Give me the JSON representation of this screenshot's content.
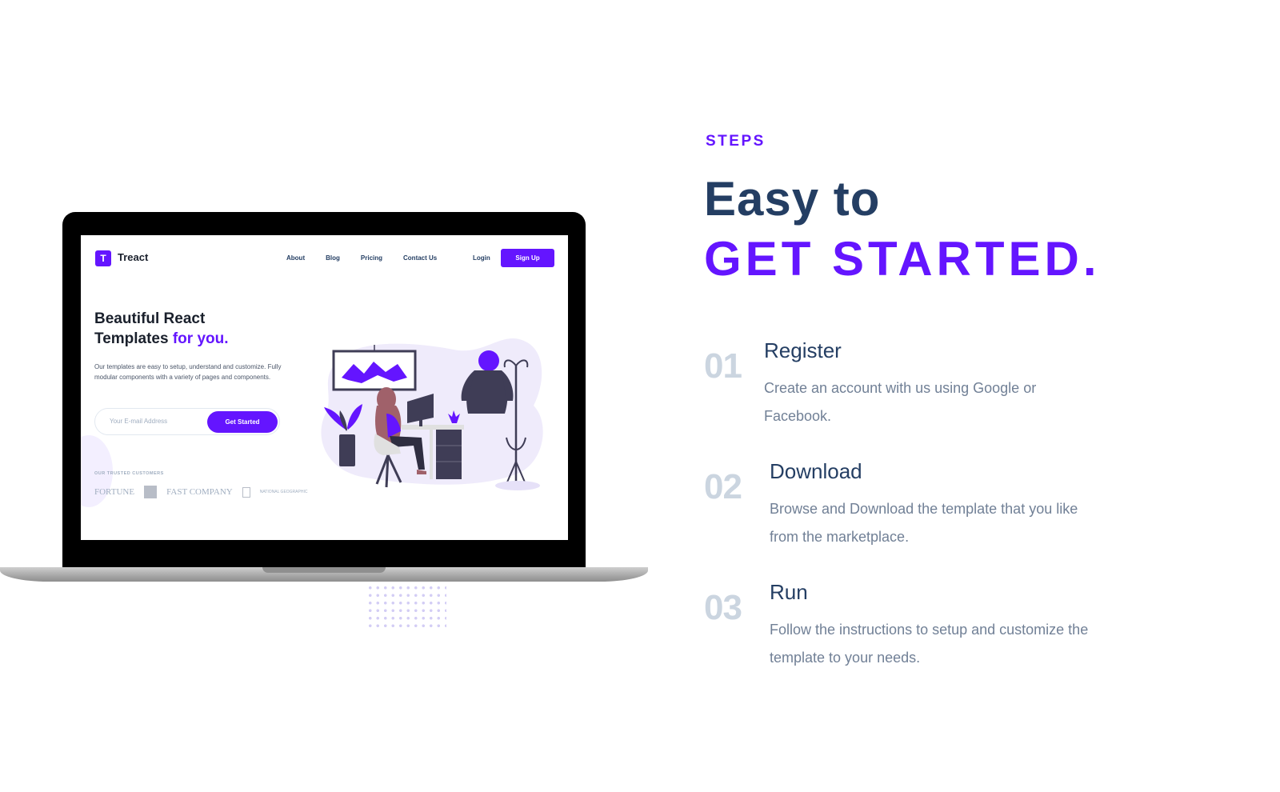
{
  "mockup": {
    "logo_letter": "T",
    "logo_text": "Treact",
    "nav_links": [
      "About",
      "Blog",
      "Pricing",
      "Contact Us"
    ],
    "login": "Login",
    "signup": "Sign Up",
    "title_line1": "Beautiful React",
    "title_line2_plain": "Templates ",
    "title_line2_accent": "for you.",
    "description": "Our templates are easy to setup, understand and customize. Fully modular components with a variety of pages and components.",
    "email_placeholder": "Your E-mail Address",
    "cta": "Get Started",
    "trusted_label": "OUR TRUSTED CUSTOMERS",
    "customer_logos": [
      "FORTUNE",
      "FAST COMPANY",
      "NATIONAL GEOGRAPHIC"
    ]
  },
  "section": {
    "subheading": "STEPS",
    "heading_line1": "Easy to",
    "heading_line2": "GET STARTED."
  },
  "steps": [
    {
      "number": "01",
      "title": "Register",
      "description": "Create an account with us using Google or Facebook."
    },
    {
      "number": "02",
      "title": "Download",
      "description": "Browse and Download the template that you like from the marketplace."
    },
    {
      "number": "03",
      "title": "Run",
      "description": "Follow the instructions to setup and customize the template to your needs."
    }
  ],
  "colors": {
    "primary": "#6415ff",
    "heading": "#243e63",
    "muted_number": "#cbd5e0",
    "body_text": "#718096"
  }
}
